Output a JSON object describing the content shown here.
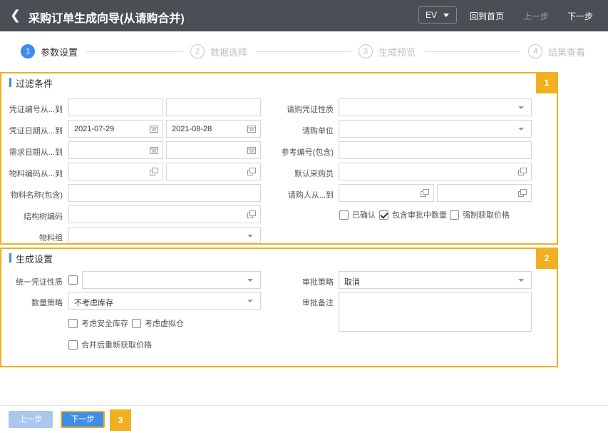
{
  "header": {
    "title": "采购订单生成向导(从请购合并)",
    "lang_select": "EV",
    "home_link": "回到首页",
    "prev_link": "上一步",
    "next_link": "下一步"
  },
  "steps": [
    {
      "num": "1",
      "label": "参数设置"
    },
    {
      "num": "2",
      "label": "数据选择"
    },
    {
      "num": "3",
      "label": "生成预览"
    },
    {
      "num": "4",
      "label": "结果查看"
    }
  ],
  "filter": {
    "title": "过滤条件",
    "badge": "1",
    "labels": {
      "voucher_no": "凭证编号从...到",
      "voucher_date": "凭证日期从...到",
      "demand_date": "需求日期从...到",
      "material_code": "物料编码从...到",
      "material_name": "物料名称(包含)",
      "struct_code": "结构树编码",
      "material_group": "物料组",
      "req_voucher_type": "请购凭证性质",
      "req_unit": "请购单位",
      "ref_no": "参考编号(包含)",
      "default_buyer": "默认采购员",
      "requester": "请购人从...到"
    },
    "values": {
      "voucher_date_from": "2021-07-29",
      "voucher_date_to": "2021-08-28"
    },
    "checkboxes": {
      "confirmed": "已确认",
      "include_approving": "包含审批中数量",
      "force_price": "强制获取价格"
    }
  },
  "generate": {
    "title": "生成设置",
    "badge": "2",
    "labels": {
      "unified_voucher_type": "统一凭证性质",
      "qty_strategy": "数量策略",
      "approval_strategy": "审批策略",
      "approval_note": "审批备注"
    },
    "values": {
      "qty_strategy": "不考虑库存",
      "approval_strategy": "取消"
    },
    "checkboxes": {
      "safety_stock": "考虑安全库存",
      "virtual_warehouse": "考虑虚拟仓",
      "refetch_price": "合并后重新获取价格"
    }
  },
  "footer": {
    "prev_button": "上一步",
    "next_button": "下一步",
    "badge": "3"
  }
}
